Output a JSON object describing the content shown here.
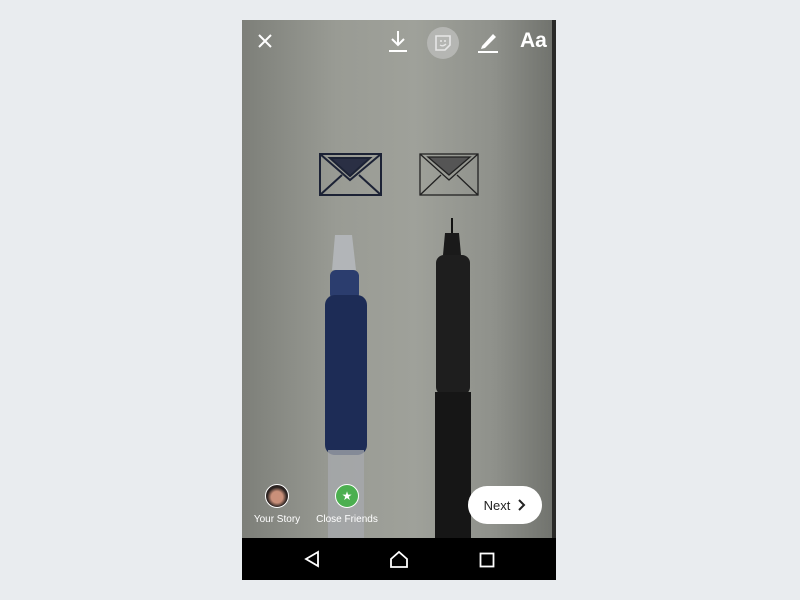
{
  "toolbar": {
    "close_icon": "close-icon",
    "download_icon": "download-icon",
    "sticker_icon": "sticker-icon",
    "draw_icon": "pen-icon",
    "text_label": "Aa"
  },
  "share": {
    "your_story": "Your Story",
    "close_friends": "Close Friends",
    "close_friends_color": "#4caf50"
  },
  "next_button": {
    "label": "Next"
  },
  "navbar": {
    "back": "back-icon",
    "home": "home-icon",
    "recents": "recents-icon"
  }
}
